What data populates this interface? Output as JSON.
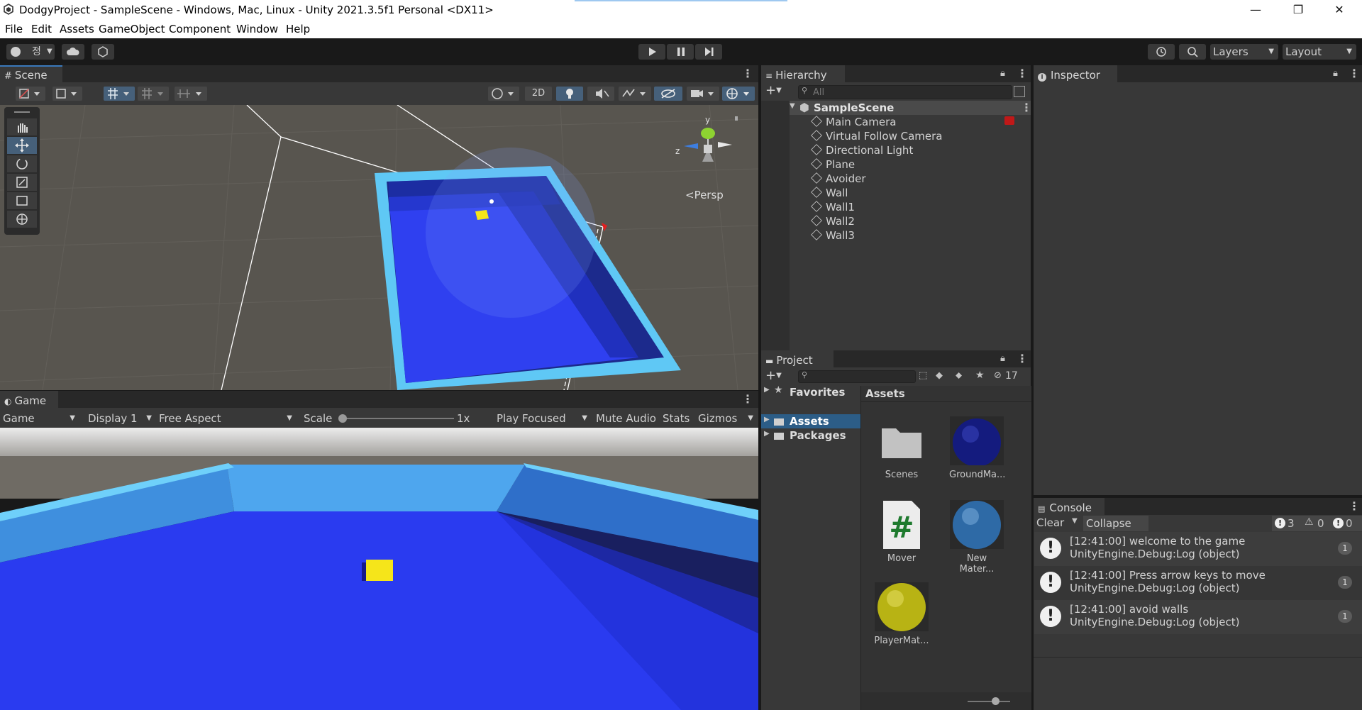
{
  "window": {
    "title": "DodgyProject - SampleScene - Windows, Mac, Linux - Unity 2021.3.5f1 Personal <DX11>",
    "minimize": "—",
    "restore": "❐",
    "close": "✕"
  },
  "menu": [
    "File",
    "Edit",
    "Assets",
    "GameObject",
    "Component",
    "Window",
    "Help"
  ],
  "toolbar": {
    "account_initial": "정",
    "layers_label": "Layers",
    "layout_label": "Layout"
  },
  "scene": {
    "tab_label": "Scene",
    "mode_2d": "2D",
    "persp_label": "<Persp",
    "gizmo_y": "y",
    "gizmo_z": "z"
  },
  "game": {
    "tab_label": "Game",
    "view_select": "Game",
    "display": "Display 1",
    "aspect": "Free Aspect",
    "scale_label": "Scale",
    "scale_value": "1x",
    "scale_fraction": 0.0,
    "play_mode": "Play Focused",
    "mute_audio": "Mute Audio",
    "stats": "Stats",
    "gizmos": "Gizmos"
  },
  "hierarchy": {
    "tab_label": "Hierarchy",
    "search_placeholder": "All",
    "scene_name": "SampleScene",
    "items": [
      "Main Camera",
      "Virtual Follow Camera",
      "Directional Light",
      "Plane",
      "Avoider",
      "Wall",
      "Wall1",
      "Wall2",
      "Wall3"
    ]
  },
  "inspector": {
    "tab_label": "Inspector"
  },
  "project": {
    "tab_label": "Project",
    "hidden_count": "17",
    "favorites": "Favorites",
    "tree": [
      "Assets",
      "Packages"
    ],
    "breadcrumb": "Assets",
    "assets": [
      {
        "name": "Scenes",
        "kind": "folder"
      },
      {
        "name": "GroundMa...",
        "kind": "material",
        "color": "#141b7e"
      },
      {
        "name": "Mover",
        "kind": "script"
      },
      {
        "name": "New Mater...",
        "kind": "material",
        "color": "#2e6aa6"
      },
      {
        "name": "PlayerMat...",
        "kind": "material",
        "color": "#b8b314"
      }
    ]
  },
  "console": {
    "tab_label": "Console",
    "clear": "Clear",
    "collapse": "Collapse",
    "count_info": "3",
    "count_warn": "0",
    "count_error": "0",
    "logs": [
      {
        "line1": "[12:41:00] welcome to the game",
        "line2": "UnityEngine.Debug:Log (object)",
        "count": "1"
      },
      {
        "line1": "[12:41:00] Press arrow keys to move",
        "line2": "UnityEngine.Debug:Log (object)",
        "count": "1"
      },
      {
        "line1": "[12:41:00] avoid walls",
        "line2": "UnityEngine.Debug:Log (object)",
        "count": "1"
      }
    ]
  },
  "colors": {
    "accent": "#3a79bb",
    "floor": "#2b3ef0",
    "wall": "#5fc8f5",
    "player": "#f5e51a",
    "scene_bg": "#57544f"
  }
}
